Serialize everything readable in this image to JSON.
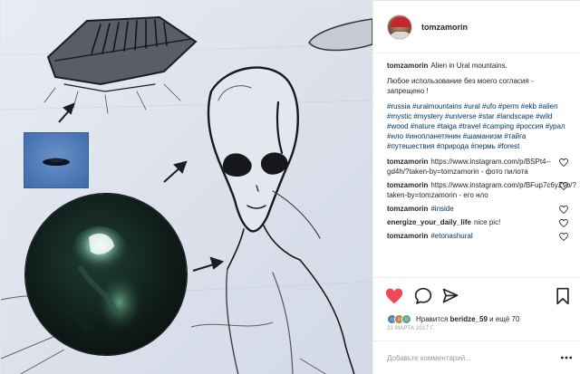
{
  "post": {
    "author": "tomzamorin",
    "caption_text": "Alien in Ural mountains.",
    "caption_note": "Любое использование без моего согласия - запрещено !",
    "hashtags": "#russia #uralmountains #ural #ufo #perm #ekb #alien #mystic #mystery #universe #star #landscape #wild #wood #nature #taiga #travel #camping #россия #урал #нло #инопланетянин #шаманизм #тайга #путешествия #природа #пермь #forest"
  },
  "comments": [
    {
      "user": "tomzamorin",
      "text": "https://www.instagram.com/p/BSPt4--gd4h/?taken-by=tomzamorin - фото пилота",
      "link": false
    },
    {
      "user": "tomzamorin",
      "text": "https://www.instagram.com/p/BFup7c6yZvo/?taken-by=tomzamorin - его нло",
      "link": false
    },
    {
      "user": "tomzamorin",
      "text": "#inside",
      "link": true
    },
    {
      "user": "energize_your_daily_life",
      "text": "nice pic!",
      "link": false
    },
    {
      "user": "tomzamorin",
      "text": "#etonashural",
      "link": true
    }
  ],
  "likes": {
    "prefix": "Нравится",
    "user": "beridze_59",
    "suffix": "и ещё 70"
  },
  "date": "31 МАРТА 2017 Г.",
  "add_comment_placeholder": "Добавьте комментарий...",
  "icons": {
    "like": "heart-icon-filled",
    "comment": "comment-icon",
    "share": "share-icon",
    "save": "bookmark-icon",
    "more": "more-dots-icon"
  },
  "colors": {
    "like_red": "#ed4956",
    "link_blue": "#003569",
    "muted": "#999999"
  }
}
